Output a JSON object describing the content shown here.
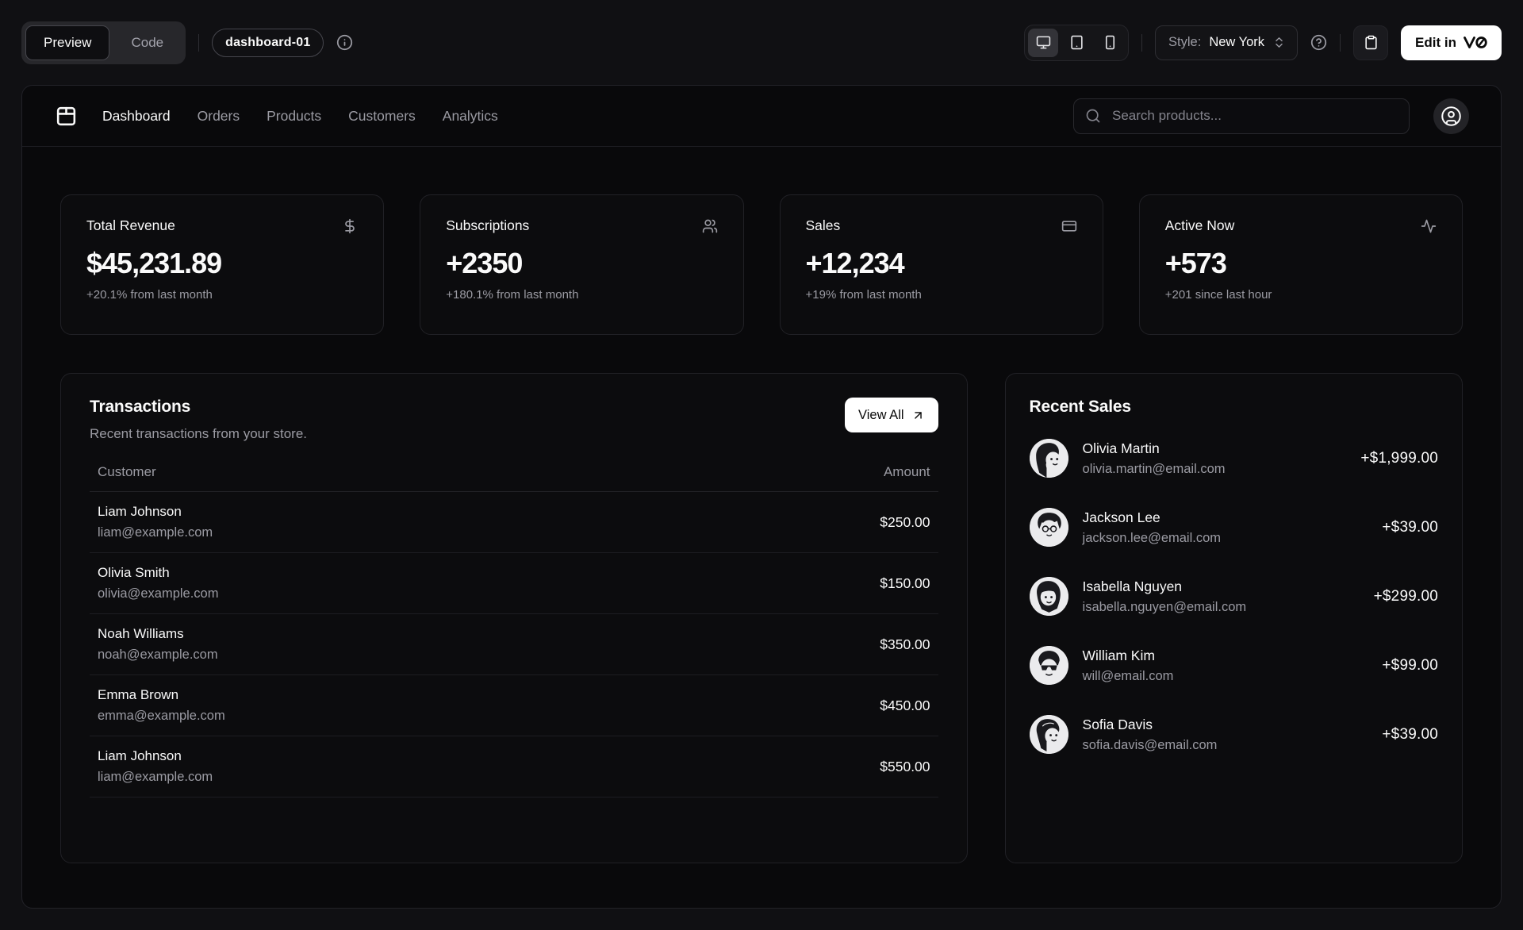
{
  "toolbar": {
    "tabs": {
      "preview": "Preview",
      "code": "Code"
    },
    "block_badge": "dashboard-01",
    "style_label": "Style:",
    "style_value": "New York",
    "edit_in_label": "Edit in",
    "icons": [
      "info-icon",
      "monitor-icon",
      "tablet-icon",
      "smartphone-icon",
      "chevrons-up-down-icon",
      "help-circle-icon",
      "clipboard-icon",
      "v0-logo"
    ]
  },
  "nav": {
    "items": [
      "Dashboard",
      "Orders",
      "Products",
      "Customers",
      "Analytics"
    ],
    "search_placeholder": "Search products...",
    "icons": [
      "store-icon",
      "search-icon",
      "circle-user-icon"
    ]
  },
  "stats": [
    {
      "title": "Total Revenue",
      "value": "$45,231.89",
      "change": "+20.1% from last month",
      "icon": "dollar-sign-icon"
    },
    {
      "title": "Subscriptions",
      "value": "+2350",
      "change": "+180.1% from last month",
      "icon": "users-icon"
    },
    {
      "title": "Sales",
      "value": "+12,234",
      "change": "+19% from last month",
      "icon": "credit-card-icon"
    },
    {
      "title": "Active Now",
      "value": "+573",
      "change": "+201 since last hour",
      "icon": "activity-icon"
    }
  ],
  "transactions": {
    "title": "Transactions",
    "description": "Recent transactions from your store.",
    "view_all_label": "View All",
    "columns": [
      "Customer",
      "Amount"
    ],
    "rows": [
      {
        "name": "Liam Johnson",
        "email": "liam@example.com",
        "amount": "$250.00"
      },
      {
        "name": "Olivia Smith",
        "email": "olivia@example.com",
        "amount": "$150.00"
      },
      {
        "name": "Noah Williams",
        "email": "noah@example.com",
        "amount": "$350.00"
      },
      {
        "name": "Emma Brown",
        "email": "emma@example.com",
        "amount": "$450.00"
      },
      {
        "name": "Liam Johnson",
        "email": "liam@example.com",
        "amount": "$550.00"
      }
    ]
  },
  "recent_sales": {
    "title": "Recent Sales",
    "rows": [
      {
        "name": "Olivia Martin",
        "email": "olivia.martin@email.com",
        "amount": "+$1,999.00"
      },
      {
        "name": "Jackson Lee",
        "email": "jackson.lee@email.com",
        "amount": "+$39.00"
      },
      {
        "name": "Isabella Nguyen",
        "email": "isabella.nguyen@email.com",
        "amount": "+$299.00"
      },
      {
        "name": "William Kim",
        "email": "will@email.com",
        "amount": "+$99.00"
      },
      {
        "name": "Sofia Davis",
        "email": "sofia.davis@email.com",
        "amount": "+$39.00"
      }
    ]
  },
  "colors": {
    "outer_background": "#101013",
    "preview_background": "#09090b",
    "card_background": "#0c0c0e",
    "border": "#222228",
    "muted_text": "#9b9ba3",
    "accent_button": "#ffffff"
  }
}
